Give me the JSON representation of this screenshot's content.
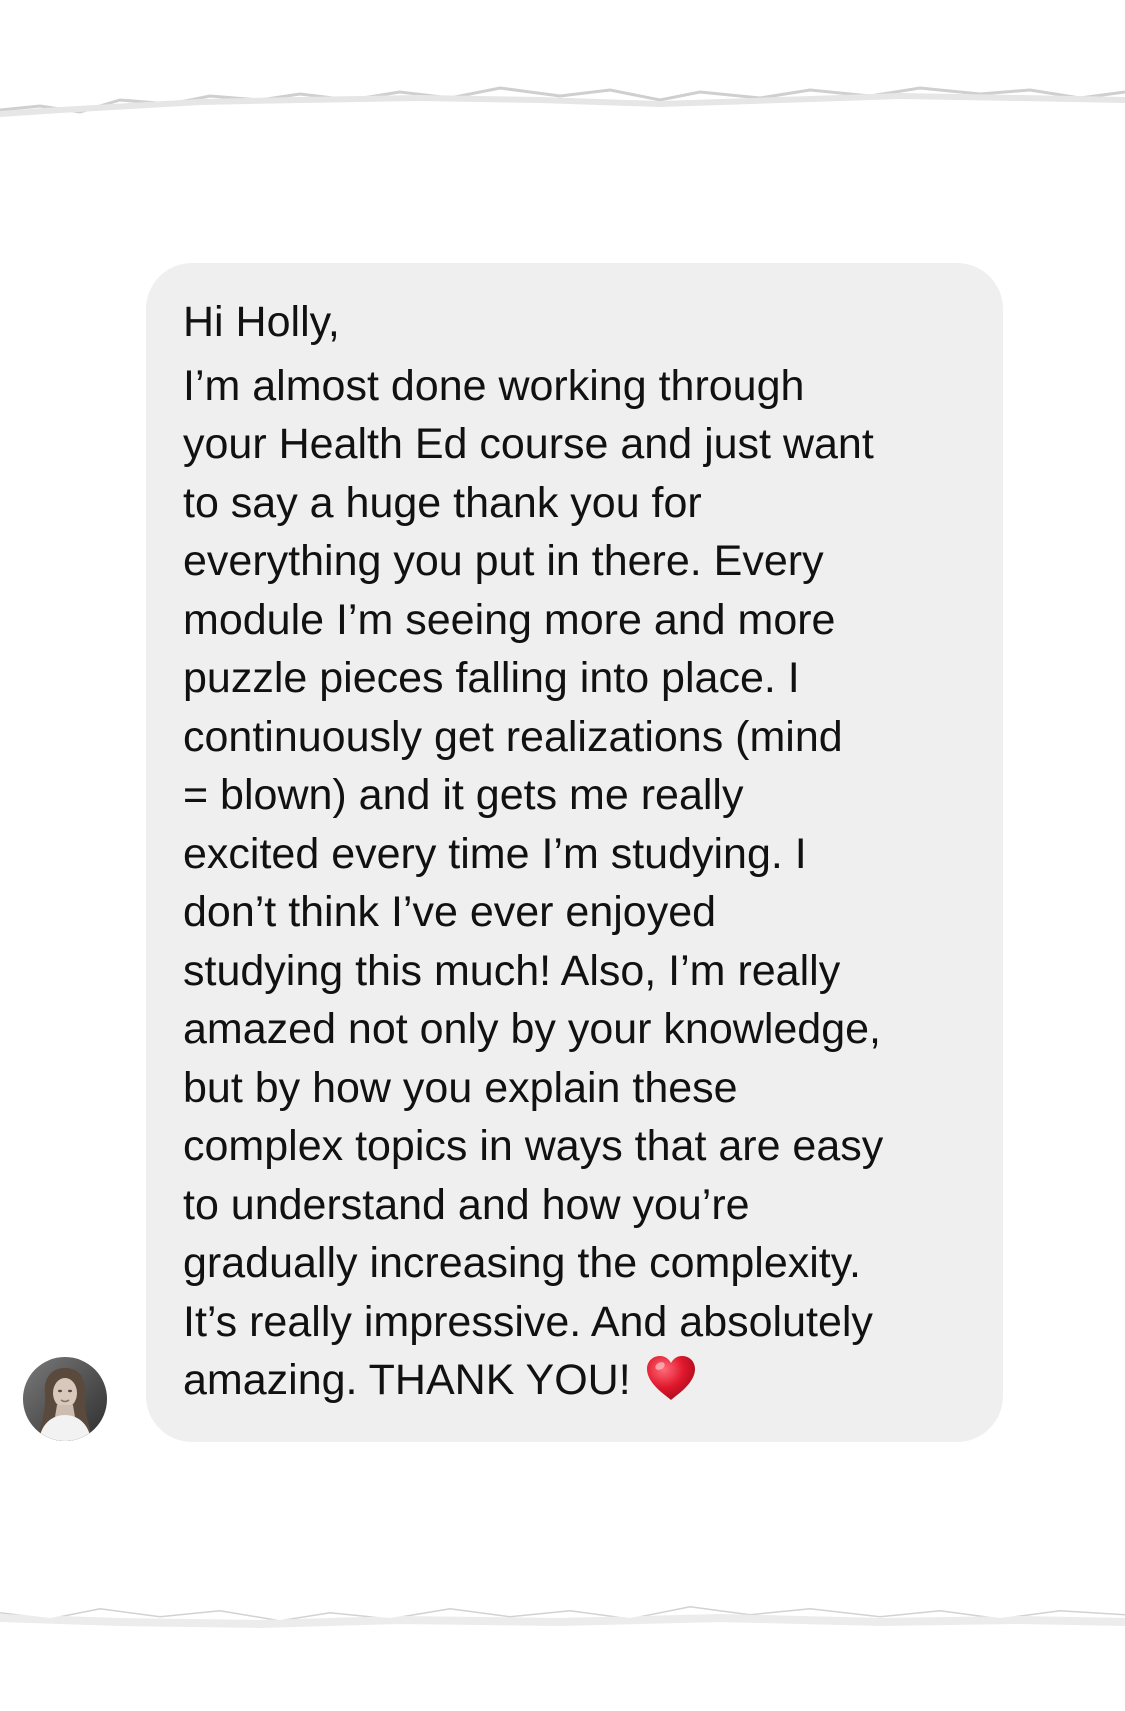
{
  "message": {
    "greeting": "Hi Holly,",
    "lines": [
      "I’m almost done working through",
      "your Health Ed course and just want",
      "to say a huge thank you for",
      "everything you put in there. Every",
      "module I’m seeing more and more",
      "puzzle pieces falling into place. I",
      "continuously get realizations (mind",
      "= blown) and it gets me really",
      "excited every time I’m studying. I",
      "don’t think I’ve ever enjoyed",
      "studying this much! Also, I’m really",
      "amazed not only by your knowledge,",
      "but by how you explain these",
      "complex topics in ways that are easy",
      "to understand and how you’re",
      "gradually increasing the complexity.",
      "It’s really impressive. And absolutely"
    ],
    "last_line": "amazing. THANK YOU!",
    "emoji": "red-heart-icon"
  },
  "sender": {
    "avatar_icon": "avatar"
  },
  "colors": {
    "bubble": "#efefef",
    "text": "#111111",
    "heart": "#e0182d",
    "background": "#ffffff"
  }
}
